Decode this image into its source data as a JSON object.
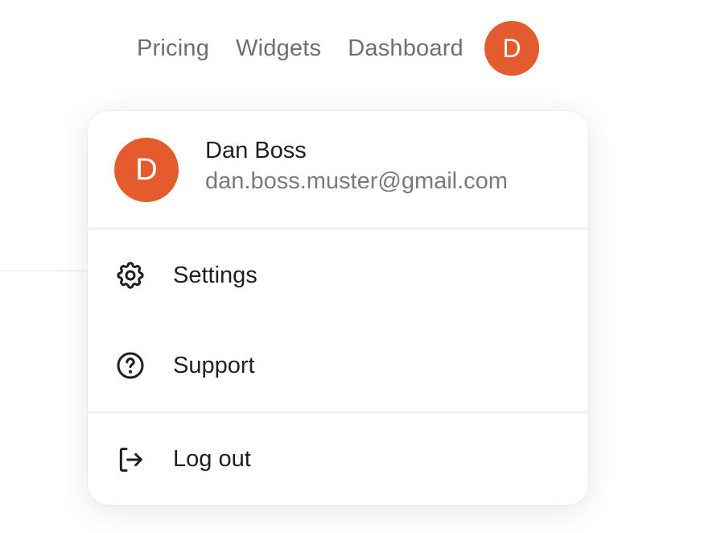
{
  "nav": {
    "links": [
      "Pricing",
      "Widgets",
      "Dashboard"
    ],
    "avatar_initial": "D"
  },
  "profile": {
    "initial": "D",
    "name": "Dan Boss",
    "email": "dan.boss.muster@gmail.com"
  },
  "menu": {
    "settings_label": "Settings",
    "settings_icon": "gear-icon",
    "support_label": "Support",
    "support_icon": "question-circle-icon",
    "logout_label": "Log out",
    "logout_icon": "logout-icon"
  },
  "colors": {
    "avatar": "#E45C2E"
  }
}
